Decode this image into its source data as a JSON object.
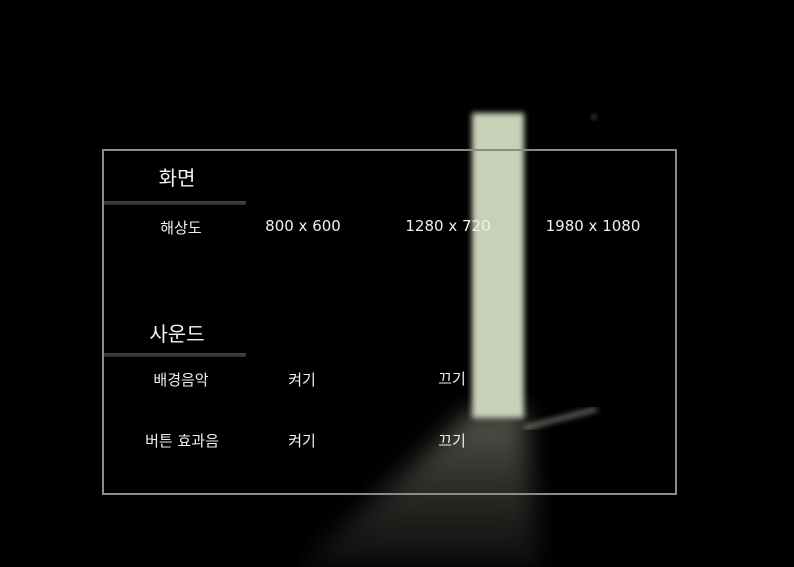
{
  "settings": {
    "screen": {
      "title": "화면",
      "resolution_label": "해상도",
      "resolutions": [
        "800 x 600",
        "1280 x 720",
        "1980 x 1080"
      ]
    },
    "sound": {
      "title": "사운드",
      "bgm_label": "배경음악",
      "bgm_on": "켜기",
      "bgm_off": "끄기",
      "sfx_label": "버튼 효과음",
      "sfx_on": "켜기",
      "sfx_off": "끄기"
    }
  },
  "colors": {
    "background": "#000000",
    "light_beam": "#c8d0b8",
    "panel_border": "#8a8a8a"
  }
}
